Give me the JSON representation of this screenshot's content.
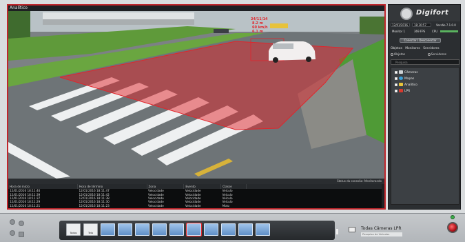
{
  "window": {
    "title": "Analítico"
  },
  "overlay": {
    "lines": [
      "24/11/14",
      "8.2 m",
      "60 km/h",
      "6.1 m"
    ]
  },
  "status": {
    "text": "Status da conexão: Monitorando"
  },
  "events": {
    "columns": [
      "Hora de início",
      "Hora de término",
      "Zona",
      "Evento",
      "Classe"
    ],
    "rows": [
      [
        "12/01/2016 18:11:46",
        "12/01/2016 18:11:47",
        "Velocidade",
        "Velocidade",
        "Veículo"
      ],
      [
        "12/01/2016 18:11:39",
        "12/01/2016 18:11:42",
        "Velocidade",
        "Velocidade",
        "Veículo"
      ],
      [
        "12/01/2016 18:11:37",
        "12/01/2016 18:11:38",
        "Velocidade",
        "Velocidade",
        "Veículo"
      ],
      [
        "12/01/2016 18:11:29",
        "12/01/2016 18:11:30",
        "Velocidade",
        "Velocidade",
        "Veículo"
      ],
      [
        "12/01/2016 18:11:21",
        "12/01/2016 18:11:23",
        "Velocidade",
        "Velocidade",
        "Moto"
      ]
    ]
  },
  "panel": {
    "brand": "Digifort",
    "date": "12/01/2016",
    "time": "18:30:57",
    "version": "Versão 7.1.0.0",
    "monitor": "Monitor 1",
    "fps": "369 FPS",
    "cpu": "CPU",
    "connect_button": "Conectar / Desconectar",
    "tabs": [
      "Objetos",
      "Monitores",
      "Servidores"
    ],
    "radio": [
      "Objetos",
      "Servidores"
    ],
    "search_placeholder": "Pesquisa",
    "tree": [
      "Câmeras",
      "Mapas",
      "Analítico",
      "LPR"
    ]
  },
  "toolbar": {
    "text_buttons": [
      "Todos",
      "Tela"
    ],
    "lpr_title": "Todas Câmeras LPR",
    "lpr_sub": "Pesquisa de Veículos"
  },
  "colors": {
    "accent": "#c0262c",
    "zone": "#e2252b",
    "layout_blue": "#5f8fc6"
  }
}
